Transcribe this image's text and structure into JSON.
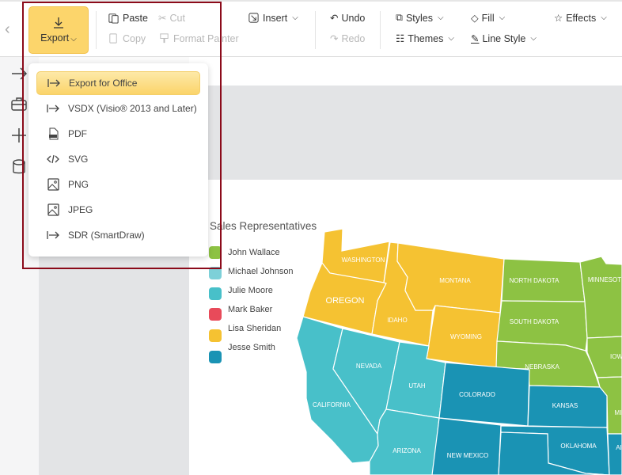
{
  "toolbar": {
    "export": "Export",
    "paste": "Paste",
    "cut": "Cut",
    "copy": "Copy",
    "format_painter": "Format Painter",
    "insert": "Insert",
    "undo": "Undo",
    "redo": "Redo",
    "styles": "Styles",
    "themes": "Themes",
    "fill": "Fill",
    "line_style": "Line Style",
    "effects": "Effects"
  },
  "export_menu": [
    {
      "label": "Export for Office",
      "icon": "export-arrow-icon",
      "active": true
    },
    {
      "label": "VSDX (Visio® 2013 and Later)",
      "icon": "export-arrow-icon"
    },
    {
      "label": "PDF",
      "icon": "pdf-file-icon"
    },
    {
      "label": "SVG",
      "icon": "code-icon"
    },
    {
      "label": "PNG",
      "icon": "image-icon"
    },
    {
      "label": "JPEG",
      "icon": "image-icon"
    },
    {
      "label": "SDR (SmartDraw)",
      "icon": "export-arrow-icon"
    }
  ],
  "legend": {
    "title": "Sales Representatives",
    "items": [
      {
        "name": "John Wallace",
        "color": "#8dc243"
      },
      {
        "name": "Michael Johnson",
        "color": "#7dd0d8"
      },
      {
        "name": "Julie Moore",
        "color": "#48c0c9"
      },
      {
        "name": "Mark Baker",
        "color": "#e84a5a"
      },
      {
        "name": "Lisa Sheridan",
        "color": "#f5c232"
      },
      {
        "name": "Jesse Smith",
        "color": "#1a93b4"
      }
    ]
  },
  "map": {
    "states": {
      "washington": "WASHINGTON",
      "oregon": "OREGON",
      "idaho": "IDAHO",
      "montana": "MONTANA",
      "wyoming": "WYOMING",
      "north_dakota": "NORTH DAKOTA",
      "south_dakota": "SOUTH DAKOTA",
      "nebraska": "NEBRASKA",
      "minnesota": "MINNESOT",
      "iowa": "IOW",
      "missouri": "MI",
      "california": "CALIFORNIA",
      "nevada": "NEVADA",
      "utah": "UTAH",
      "arizona": "ARIZONA",
      "colorado": "COLORADO",
      "new_mexico": "NEW MEXICO",
      "kansas": "KANSAS",
      "oklahoma": "OKLAHOMA",
      "arkansas": "AI"
    }
  }
}
